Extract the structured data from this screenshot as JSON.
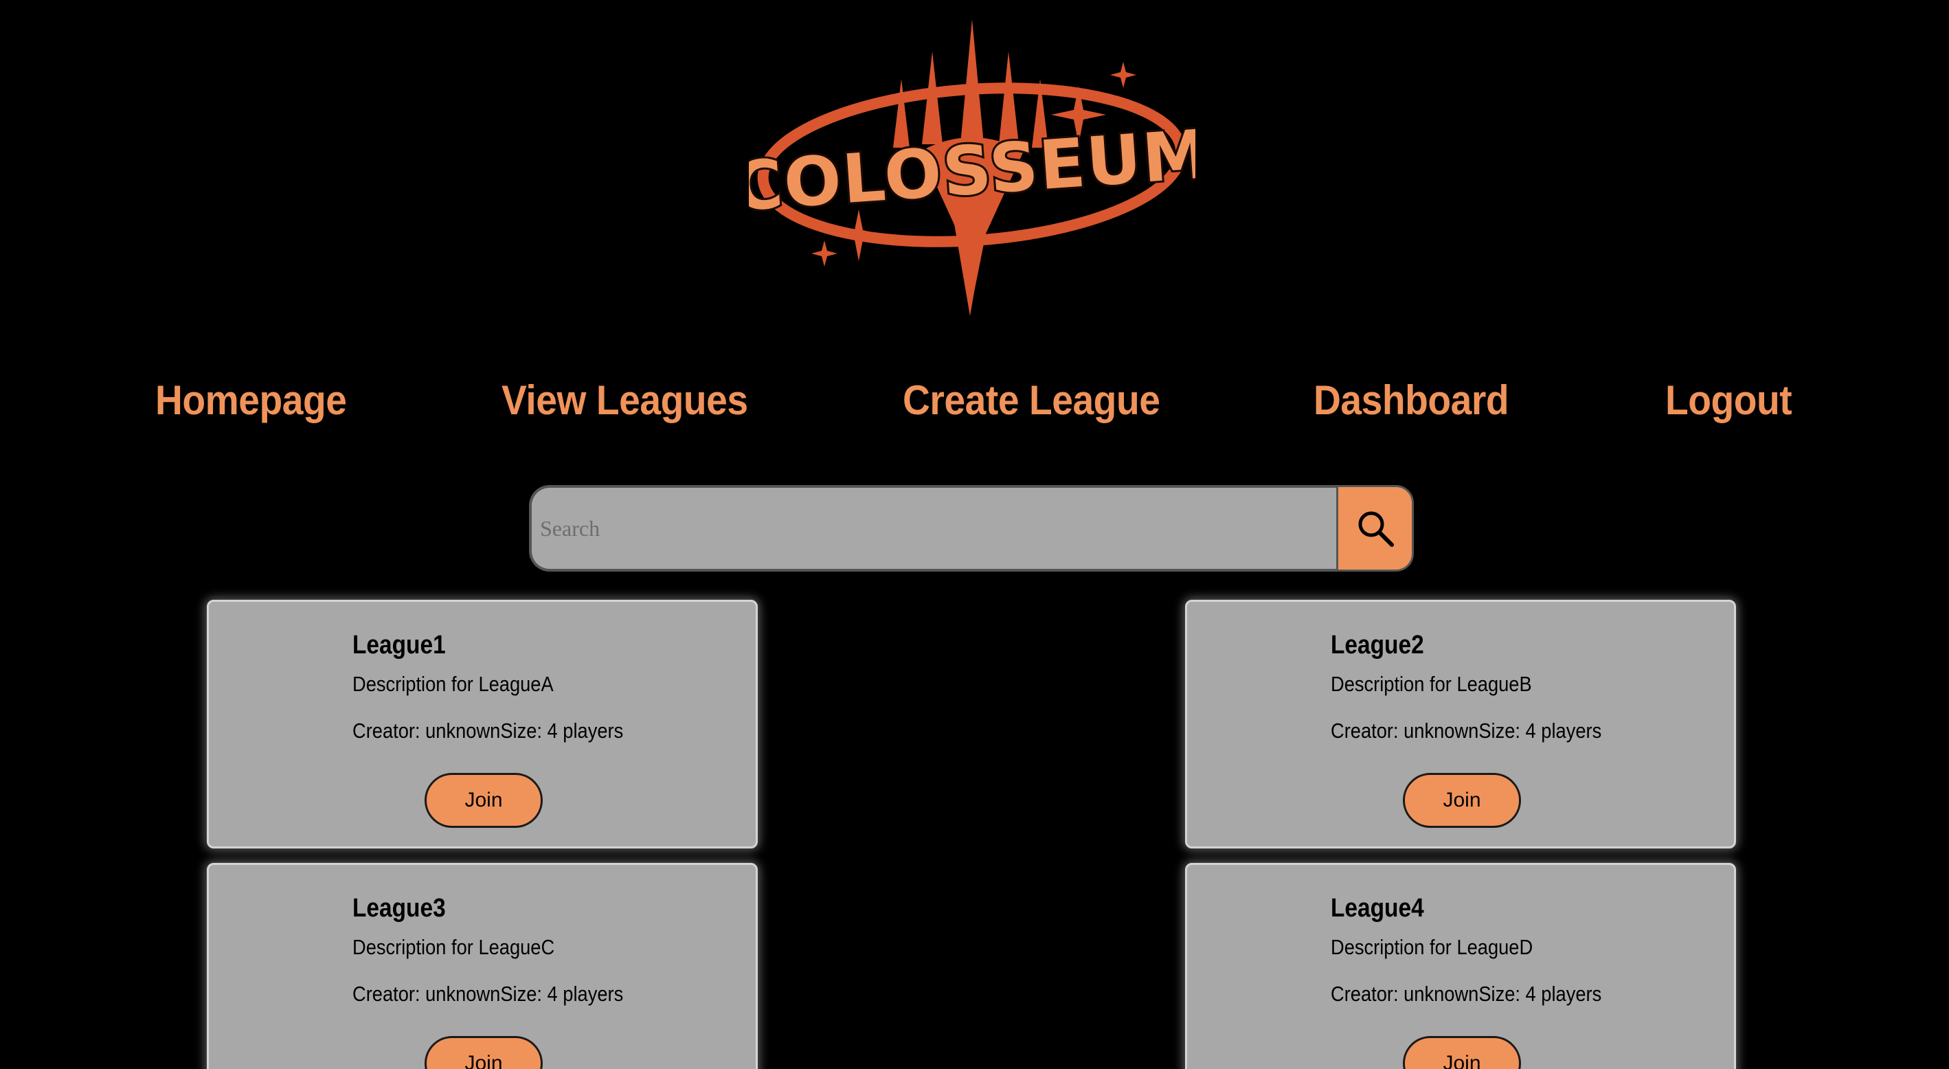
{
  "app": {
    "logo_text": "COLOSSEUM"
  },
  "colors": {
    "background": "#000000",
    "accent": "#F0935A",
    "logo_red": "#D9562E",
    "card_bg": "#A8A8A8"
  },
  "nav": {
    "items": [
      {
        "label": "Homepage"
      },
      {
        "label": "View Leagues"
      },
      {
        "label": "Create League"
      },
      {
        "label": "Dashboard"
      },
      {
        "label": "Logout"
      }
    ]
  },
  "search": {
    "placeholder": "Search",
    "icon": "search-icon"
  },
  "leagues": [
    {
      "name": "League1",
      "description": "Description for LeagueA",
      "meta": "Creator: unknownSize: 4 players",
      "join_label": "Join"
    },
    {
      "name": "League2",
      "description": "Description for LeagueB",
      "meta": "Creator: unknownSize: 4 players",
      "join_label": "Join"
    },
    {
      "name": "League3",
      "description": "Description for LeagueC",
      "meta": "Creator: unknownSize: 4 players",
      "join_label": "Join"
    },
    {
      "name": "League4",
      "description": "Description for LeagueD",
      "meta": "Creator: unknownSize: 4 players",
      "join_label": "Join"
    }
  ]
}
